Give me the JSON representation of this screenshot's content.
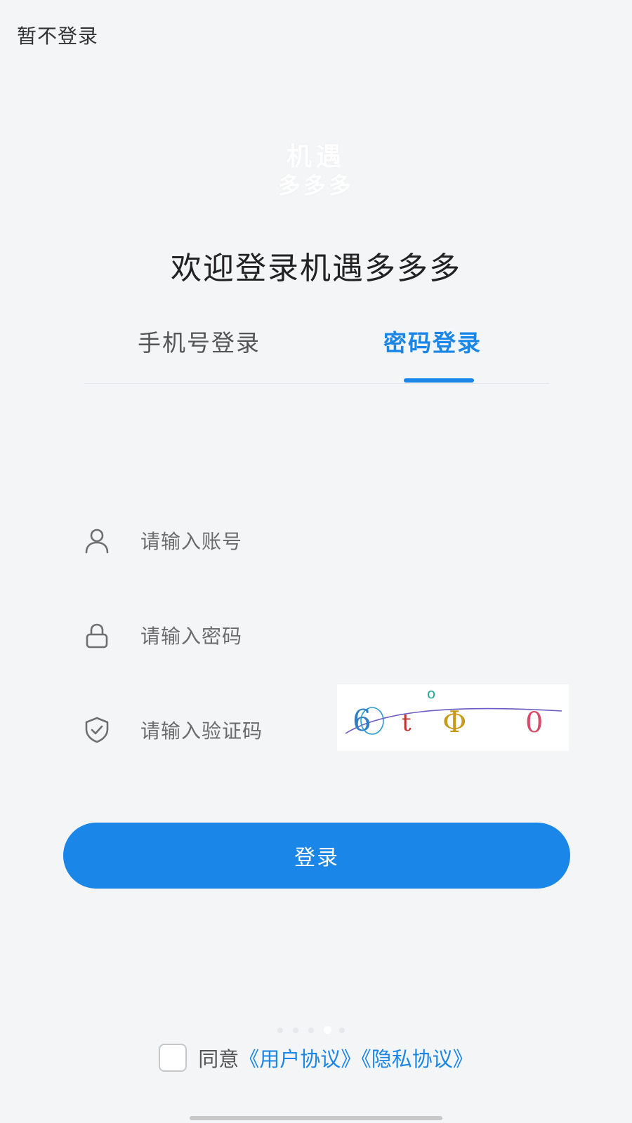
{
  "header": {
    "skip_login": "暂不登录"
  },
  "logo": {
    "line1": "机遇",
    "line2": "多多多"
  },
  "welcome_title": "欢迎登录机遇多多多",
  "tabs": [
    {
      "label": "手机号登录",
      "active": false
    },
    {
      "label": "密码登录",
      "active": true
    }
  ],
  "form": {
    "account": {
      "placeholder": "请输入账号",
      "value": "",
      "icon": "user-icon"
    },
    "password": {
      "placeholder": "请输入密码",
      "value": "",
      "icon": "lock-icon"
    },
    "captcha": {
      "placeholder": "请输入验证码",
      "value": "",
      "icon": "shield-check-icon",
      "image_chars": [
        "6",
        "t",
        "Φ",
        "0"
      ],
      "image_dot": "o"
    }
  },
  "login_button": "登录",
  "carousel": {
    "dot_count": 5,
    "active_index": 3
  },
  "agreement": {
    "agree_text": "同意",
    "user_agreement": "《用户协议》",
    "privacy_agreement": "《隐私协议》",
    "checked": false
  },
  "colors": {
    "accent": "#1a86e8",
    "background": "#f4f5f7",
    "title": "#222222",
    "icon": "#6f6f6f"
  }
}
